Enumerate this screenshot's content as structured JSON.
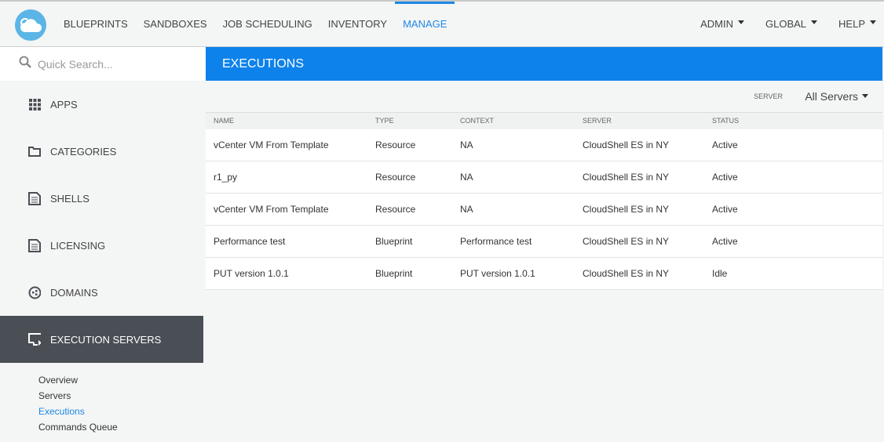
{
  "nav": {
    "items": [
      "BLUEPRINTS",
      "SANDBOXES",
      "JOB SCHEDULING",
      "INVENTORY",
      "MANAGE"
    ],
    "active": "MANAGE",
    "right": [
      "ADMIN",
      "GLOBAL",
      "HELP"
    ]
  },
  "search": {
    "placeholder": "Quick Search..."
  },
  "sidebar": {
    "items": [
      {
        "label": "APPS",
        "icon": "apps-icon"
      },
      {
        "label": "CATEGORIES",
        "icon": "folder-icon"
      },
      {
        "label": "SHELLS",
        "icon": "document-icon"
      },
      {
        "label": "LICENSING",
        "icon": "document-icon"
      },
      {
        "label": "DOMAINS",
        "icon": "domains-icon"
      },
      {
        "label": "EXECUTION SERVERS",
        "icon": "execution-server-icon"
      }
    ],
    "subitems": [
      "Overview",
      "Servers",
      "Executions",
      "Commands Queue"
    ]
  },
  "page": {
    "title": "EXECUTIONS",
    "server_label": "SERVER",
    "server_value": "All Servers"
  },
  "table": {
    "headers": [
      "NAME",
      "TYPE",
      "CONTEXT",
      "SERVER",
      "STATUS"
    ],
    "rows": [
      [
        "vCenter VM From Template",
        "Resource",
        "NA",
        "CloudShell ES in NY",
        "Active"
      ],
      [
        "r1_py",
        "Resource",
        "NA",
        "CloudShell ES in NY",
        "Active"
      ],
      [
        "vCenter VM From Template",
        "Resource",
        "NA",
        "CloudShell ES in NY",
        "Active"
      ],
      [
        "Performance test",
        "Blueprint",
        "Performance test",
        "CloudShell ES in NY",
        "Active"
      ],
      [
        "PUT version 1.0.1",
        "Blueprint",
        "PUT version 1.0.1",
        "CloudShell ES in NY",
        "Idle"
      ]
    ]
  }
}
